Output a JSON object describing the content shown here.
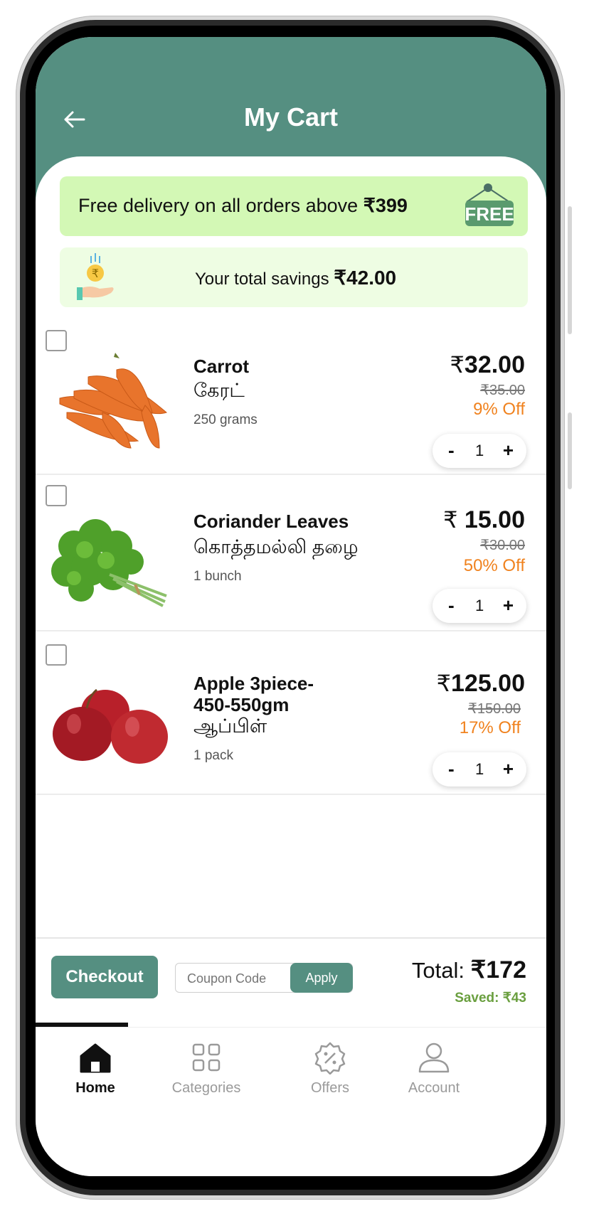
{
  "header": {
    "title": "My Cart"
  },
  "banner": {
    "text": "Free delivery on all orders above ",
    "amount": "₹399",
    "tag": "FREE"
  },
  "savings": {
    "text": "Your total savings ",
    "amount": "₹42.00"
  },
  "items": [
    {
      "name": "Carrot",
      "local_name": "கேரட்",
      "quantity": "250 grams",
      "price_symbol": "₹",
      "price": "32.00",
      "mrp": "₹35.00",
      "discount": "9% Off",
      "count": "1",
      "minus": "-",
      "plus": "+"
    },
    {
      "name": "Coriander Leaves",
      "local_name": "கொத்தமல்லி தழை",
      "quantity": "1 bunch",
      "price_symbol": "₹",
      "price": "15.00",
      "mrp": "₹30.00",
      "discount": "50% Off",
      "count": "1",
      "minus": "-",
      "plus": "+"
    },
    {
      "name": "Apple 3piece-450-550gm",
      "local_name": "ஆப்பிள்",
      "quantity": "1 pack",
      "price_symbol": "₹",
      "price": "125.00",
      "mrp": "₹150.00",
      "discount": "17% Off",
      "count": "1",
      "minus": "-",
      "plus": "+"
    }
  ],
  "footer": {
    "checkout_label": "Checkout",
    "coupon_placeholder": "Coupon Code",
    "apply_label": "Apply",
    "total_label": "Total: ",
    "total_value": "₹172",
    "saved_label": "Saved:  ₹43"
  },
  "nav": [
    {
      "label": "Home",
      "icon": "home-icon",
      "active": true
    },
    {
      "label": "Categories",
      "icon": "grid-icon",
      "active": false
    },
    {
      "label": "Offers",
      "icon": "discount-badge-icon",
      "active": false
    },
    {
      "label": "Account",
      "icon": "user-icon",
      "active": false
    }
  ],
  "colors": {
    "primary": "#558f81",
    "banner_bg": "#d3f8b5",
    "savings_bg": "#eefde3",
    "discount": "#f0821e",
    "saved": "#6a9f3f"
  }
}
